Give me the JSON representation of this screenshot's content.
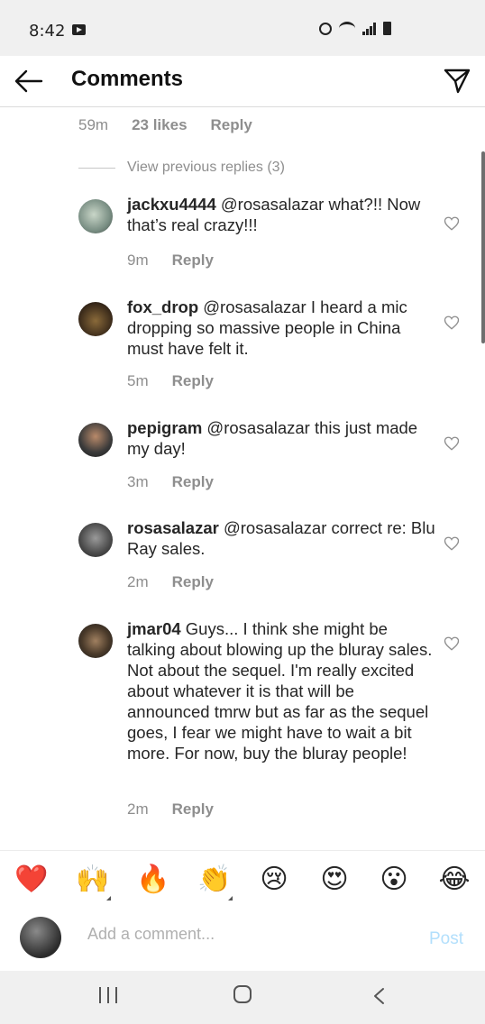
{
  "status_bar": {
    "time": "8:42"
  },
  "header": {
    "title": "Comments"
  },
  "top_comment_meta": {
    "time": "59m",
    "likes": "23 likes",
    "reply": "Reply"
  },
  "view_previous": "View previous replies (3)",
  "replies": [
    {
      "username": "jackxu4444",
      "text": " @rosasalazar what?!! Now that’s real crazy!!!",
      "time": "9m",
      "reply": "Reply"
    },
    {
      "username": "fox_drop",
      "text": " @rosasalazar I heard a mic dropping so massive people in China must have felt it.",
      "time": "5m",
      "reply": "Reply"
    },
    {
      "username": "pepigram",
      "text": " @rosasalazar this just made my day!",
      "time": "3m",
      "reply": "Reply"
    },
    {
      "username": "rosasalazar",
      "text": " @rosasalazar correct re: Blu Ray sales.",
      "time": "2m",
      "reply": "Reply"
    },
    {
      "username": "jmar04",
      "text": " Guys... I think she might be talking about blowing up the bluray sales. Not about the sequel. I'm really excited about whatever it is that will be announced tmrw but as far as the sequel goes, I fear we might have to wait a bit more. For now, buy the bluray people!",
      "time": "2m",
      "reply": "Reply"
    }
  ],
  "emoji_bar": {
    "items": [
      "❤️",
      "🙌",
      "🔥",
      "👏",
      "😢",
      "😍",
      "😮",
      "😂"
    ]
  },
  "comment_input": {
    "placeholder": "Add a comment...",
    "post_label": "Post"
  },
  "colors": {
    "accent_post": "#b2dffc",
    "muted_text": "#8e8e8e",
    "text": "#262626"
  }
}
